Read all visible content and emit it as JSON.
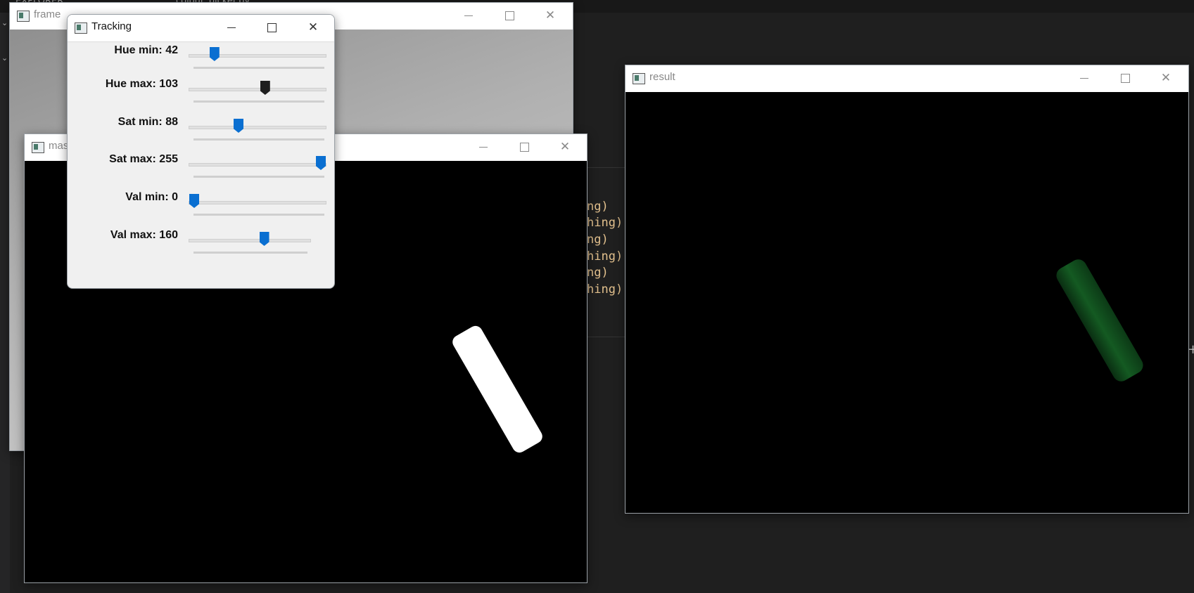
{
  "background_editor": {
    "top_left_text": "EXPLORER",
    "tab_text": "colour_picker.py",
    "code_tail_lines": [
      "ng)",
      "hing)",
      "ng)",
      "hing)",
      "ng)",
      "hing)"
    ]
  },
  "windows": {
    "frame": {
      "title": "frame"
    },
    "mask": {
      "title": "mask"
    },
    "result": {
      "title": "result"
    },
    "tracking": {
      "title": "Tracking"
    }
  },
  "trackbars": [
    {
      "label": "Hue min: 42",
      "fraction": 0.16
    },
    {
      "label": "Hue max: 103",
      "fraction": 0.56
    },
    {
      "label": "Sat min: 88",
      "fraction": 0.35
    },
    {
      "label": "Sat max: 255",
      "fraction": 1.0
    },
    {
      "label": "Val min: 0",
      "fraction": 0.0
    },
    {
      "label": "Val max: 160",
      "fraction": 0.63
    }
  ],
  "colors": {
    "slider_thumb": "#0a6fd1",
    "slider_thumb_active": "#1f1f1f",
    "mask_object": "#ffffff",
    "result_object": "#145a22"
  }
}
